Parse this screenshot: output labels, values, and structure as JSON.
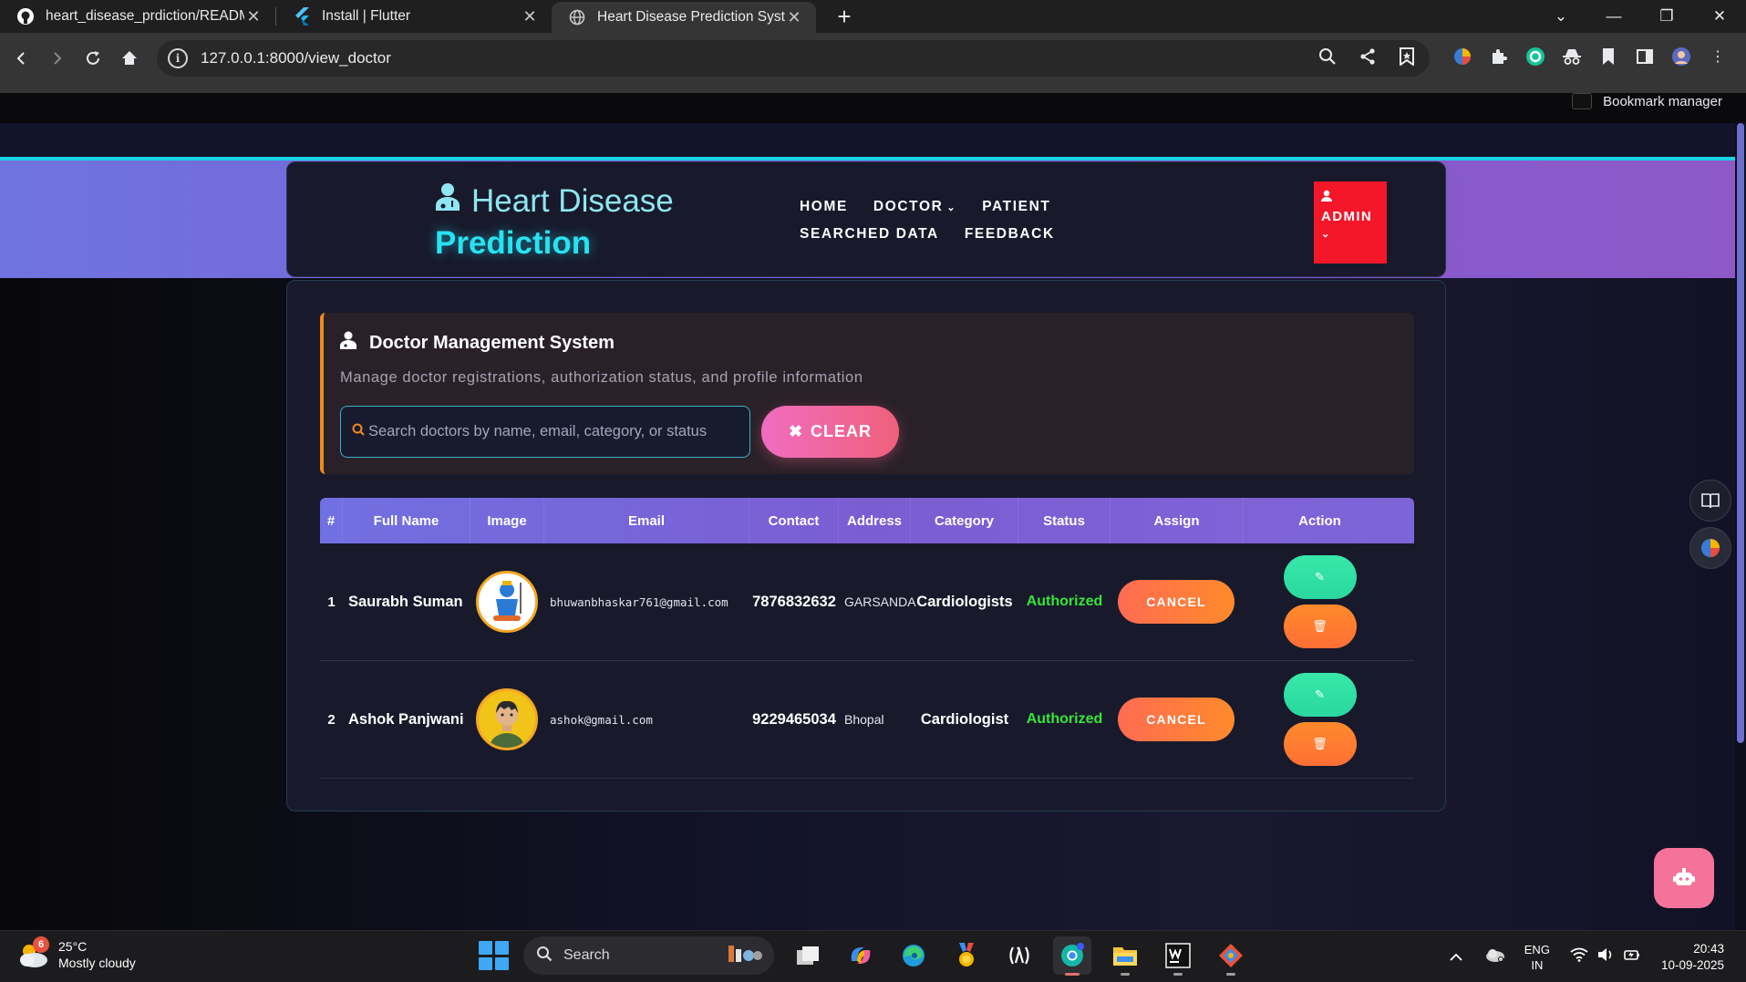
{
  "browser": {
    "tabs": [
      {
        "title": "heart_disease_prdiction/README.md",
        "active": false
      },
      {
        "title": "Install | Flutter",
        "active": false
      },
      {
        "title": "Heart Disease Prediction System",
        "active": true
      }
    ],
    "url": "127.0.0.1:8000/view_doctor",
    "bookmark_manager": "Bookmark manager"
  },
  "navbar": {
    "brand_line1": "Heart Disease",
    "brand_line2": "Prediction",
    "links": {
      "home": "HOME",
      "doctor": "DOCTOR",
      "patient": "PATIENT",
      "searched": "SEARCHED DATA",
      "feedback": "FEEDBACK"
    },
    "admin": "ADMIN"
  },
  "dms": {
    "title": "Doctor Management System",
    "subtitle": "Manage doctor registrations, authorization status, and profile information",
    "search_placeholder": "Search doctors by name, email, category, or status",
    "clear_label": "CLEAR"
  },
  "table": {
    "headers": [
      "#",
      "Full Name",
      "Image",
      "Email",
      "Contact",
      "Address",
      "Category",
      "Status",
      "Assign",
      "Action"
    ],
    "rows": [
      {
        "index": "1",
        "name": "Saurabh Suman",
        "email": "bhuwanbhaskar761@gmail.com",
        "contact": "7876832632",
        "address": "GARSANDA",
        "category": "Cardiologists",
        "status": "Authorized",
        "assign": "CANCEL"
      },
      {
        "index": "2",
        "name": "Ashok Panjwani",
        "email": "ashok@gmail.com",
        "contact": "9229465034",
        "address": "Bhopal",
        "category": "Cardiologist",
        "status": "Authorized",
        "assign": "CANCEL"
      }
    ]
  },
  "taskbar": {
    "weather_temp": "25°C",
    "weather_desc": "Mostly cloudy",
    "weather_badge": "6",
    "search_label": "Search",
    "lang_line1": "ENG",
    "lang_line2": "IN",
    "time": "20:43",
    "date": "10-09-2025"
  },
  "colors": {
    "accent_cyan": "#27e3f2",
    "header_purple": "#7a5bd6",
    "status_green": "#37e43a",
    "cancel_orange": "#ff7a3a",
    "clear_pink": "#f06dc0",
    "admin_red": "#f41629"
  }
}
